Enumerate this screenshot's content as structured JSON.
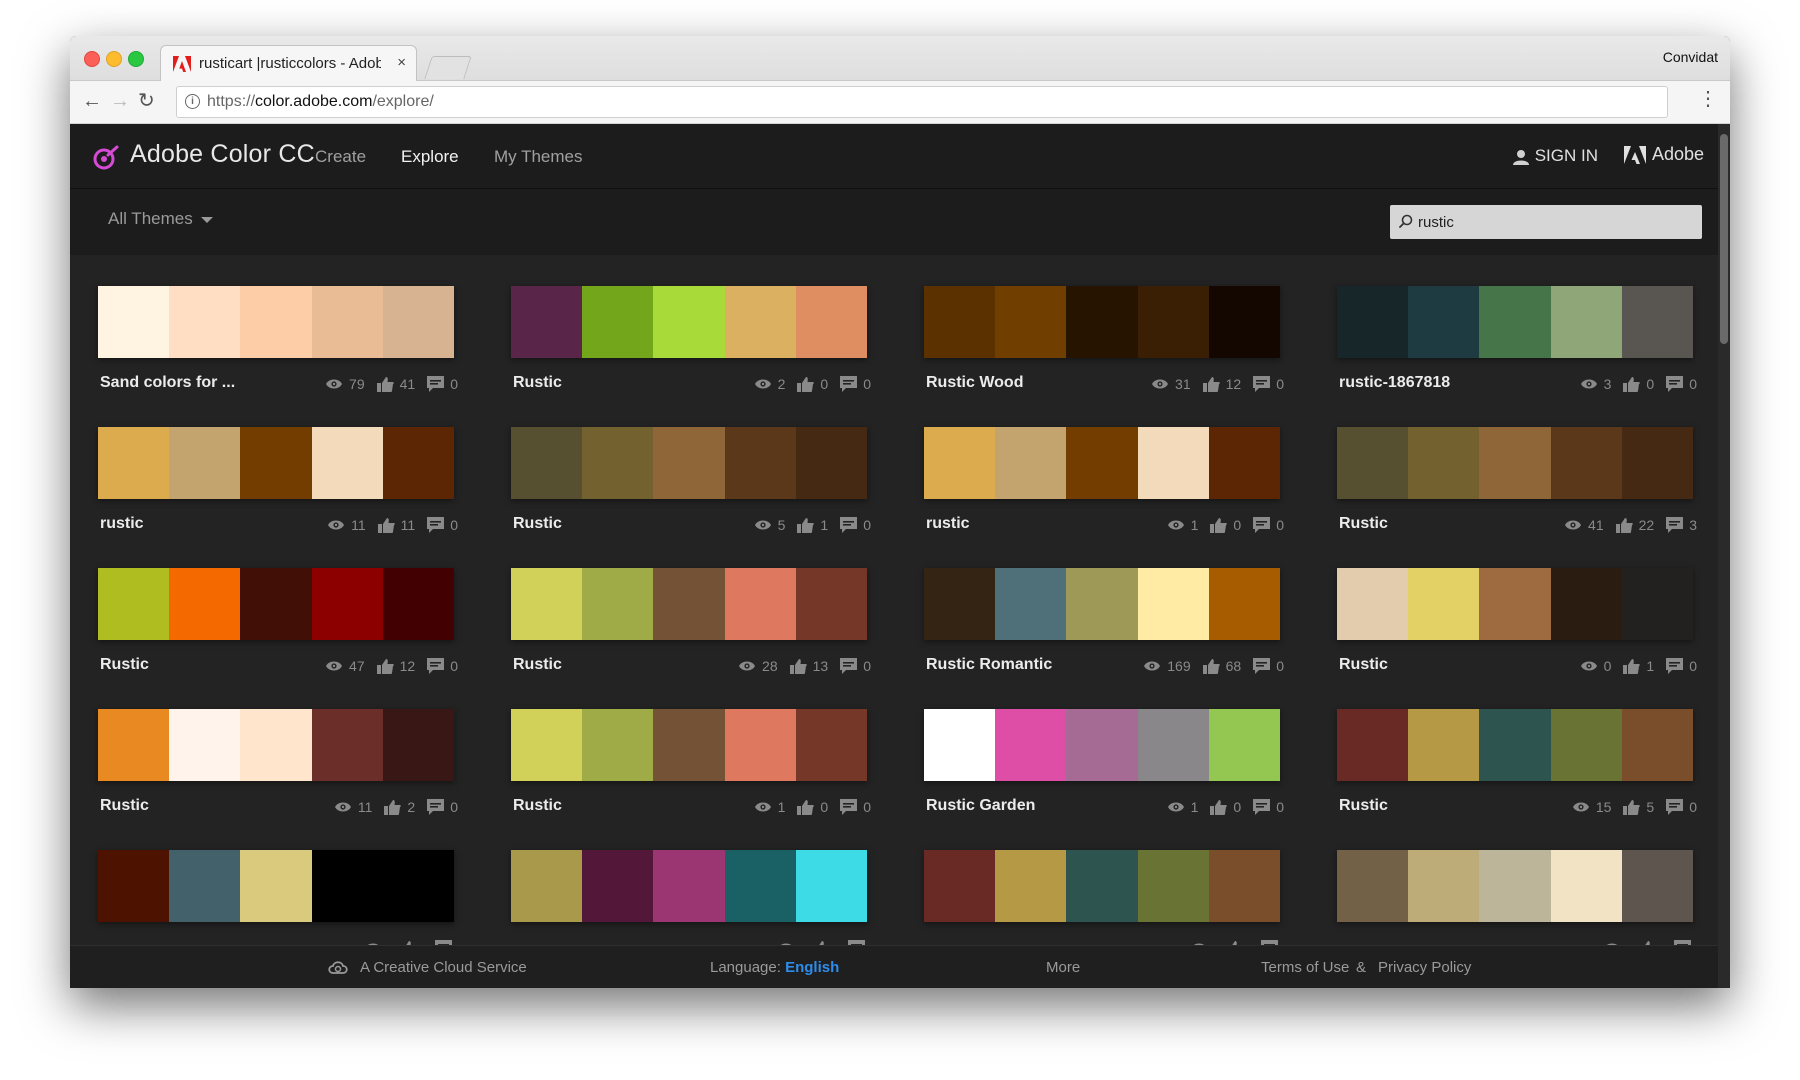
{
  "browser": {
    "tab_title": "rusticart |rusticcolors - Adobe",
    "tab_close": "×",
    "profile": "Convidat",
    "url_prefix": "https://",
    "url_host": "color.adobe.com",
    "url_path": "/explore/"
  },
  "header": {
    "app_name": "Adobe Color CC",
    "nav": [
      "Create",
      "Explore",
      "My Themes"
    ],
    "active_nav": "Explore",
    "sign_in": "SIGN IN",
    "adobe": "Adobe"
  },
  "filter": {
    "dropdown": "All Themes",
    "search_value": "rustic"
  },
  "themes": [
    {
      "title": "Sand colors for ...",
      "views": "79",
      "likes": "41",
      "comments": "0",
      "colors": [
        "#FFF3E2",
        "#FFDEC4",
        "#FCCDA7",
        "#EABC95",
        "#D7B392"
      ]
    },
    {
      "title": "Rustic",
      "views": "2",
      "likes": "0",
      "comments": "0",
      "colors": [
        "#59264A",
        "#73A61A",
        "#A8DB3A",
        "#DBB061",
        "#DE8E61"
      ]
    },
    {
      "title": "Rustic Wood",
      "views": "31",
      "likes": "12",
      "comments": "0",
      "colors": [
        "#5C3100",
        "#703F00",
        "#261300",
        "#3B1F05",
        "#140700"
      ]
    },
    {
      "title": "rustic-1867818",
      "views": "3",
      "likes": "0",
      "comments": "0",
      "colors": [
        "#172629",
        "#1E3B42",
        "#47754A",
        "#8FA679",
        "#595551"
      ]
    },
    {
      "title": "rustic",
      "views": "11",
      "likes": "11",
      "comments": "0",
      "colors": [
        "#DBAB4D",
        "#C4A46E",
        "#733D00",
        "#F2DABA",
        "#5C2605"
      ]
    },
    {
      "title": "Rustic",
      "views": "5",
      "likes": "1",
      "comments": "0",
      "colors": [
        "#575030",
        "#736130",
        "#8F6638",
        "#5C381A",
        "#452912"
      ]
    },
    {
      "title": "rustic",
      "views": "1",
      "likes": "0",
      "comments": "0",
      "colors": [
        "#DBAB4D",
        "#C4A46E",
        "#733D00",
        "#F2DABA",
        "#5C2605"
      ]
    },
    {
      "title": "Rustic",
      "views": "41",
      "likes": "22",
      "comments": "3",
      "colors": [
        "#575030",
        "#736130",
        "#8F6638",
        "#5C381A",
        "#452912"
      ]
    },
    {
      "title": "Rustic",
      "views": "47",
      "likes": "12",
      "comments": "0",
      "colors": [
        "#B0BD21",
        "#F56A00",
        "#420F07",
        "#8C0000",
        "#420003"
      ]
    },
    {
      "title": "Rustic",
      "views": "28",
      "likes": "13",
      "comments": "0",
      "colors": [
        "#D1D15A",
        "#9EAB47",
        "#735236",
        "#DE785E",
        "#753828"
      ]
    },
    {
      "title": "Rustic Romantic",
      "views": "169",
      "likes": "68",
      "comments": "0",
      "colors": [
        "#332414",
        "#4F7078",
        "#9E9957",
        "#FFEBA3",
        "#A85C00"
      ]
    },
    {
      "title": "Rustic",
      "views": "0",
      "likes": "1",
      "comments": "0",
      "colors": [
        "#E3CCAD",
        "#E3D166",
        "#9E6B40",
        "#2B1C12",
        "#22211F"
      ]
    },
    {
      "title": "Rustic",
      "views": "11",
      "likes": "2",
      "comments": "0",
      "colors": [
        "#E88A21",
        "#FFF3EB",
        "#FFE5CC",
        "#6B2E29",
        "#381714"
      ]
    },
    {
      "title": "Rustic",
      "views": "1",
      "likes": "0",
      "comments": "0",
      "colors": [
        "#D1D15A",
        "#9EAB47",
        "#735236",
        "#DE785E",
        "#753828"
      ]
    },
    {
      "title": "Rustic Garden",
      "views": "1",
      "likes": "0",
      "comments": "0",
      "colors": [
        "#FFFFFF",
        "#DE4DA6",
        "#A66B94",
        "#8A878A",
        "#94C752"
      ]
    },
    {
      "title": "Rustic",
      "views": "15",
      "likes": "5",
      "comments": "0",
      "colors": [
        "#692924",
        "#B59945",
        "#2E544F",
        "#697333",
        "#7A4D2B"
      ]
    },
    {
      "title": "",
      "views": "",
      "likes": "",
      "comments": "",
      "colors": [
        "#4D1200",
        "#42616B",
        "#D9CA7D",
        "#000000",
        "#000000"
      ]
    },
    {
      "title": "",
      "views": "",
      "likes": "",
      "comments": "",
      "colors": [
        "#A89A4A",
        "#521739",
        "#9C3673",
        "#1A6166",
        "#3DDBE6"
      ]
    },
    {
      "title": "",
      "views": "",
      "likes": "",
      "comments": "",
      "colors": [
        "#692924",
        "#B59945",
        "#2E544F",
        "#697333",
        "#7A4D2B"
      ]
    },
    {
      "title": "",
      "views": "",
      "likes": "",
      "comments": "",
      "colors": [
        "#736147",
        "#BDAB78",
        "#BDB599",
        "#F2E3C4",
        "#5E554F"
      ]
    }
  ],
  "footer": {
    "cc_service": "A Creative Cloud Service",
    "language_label": "Language:",
    "language_value": "English",
    "more": "More",
    "terms": "Terms of Use",
    "amp": "&",
    "privacy": "Privacy Policy"
  }
}
